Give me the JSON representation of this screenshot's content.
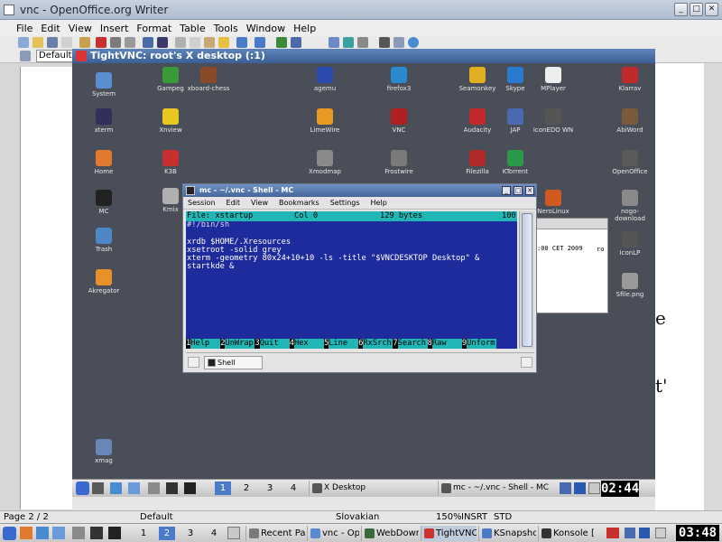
{
  "openoffice": {
    "title": "vnc - OpenOffice.org Writer",
    "menu": [
      "File",
      "Edit",
      "View",
      "Insert",
      "Format",
      "Table",
      "Tools",
      "Window",
      "Help"
    ],
    "paragraph_style": "Default",
    "status": {
      "page": "Page 2 / 2",
      "style": "Default",
      "language": "Slovakian",
      "zoom": "150%",
      "insert_mode": "INSRT",
      "selection_mode": "STD"
    },
    "page_glyphs": [
      "e",
      "t'"
    ]
  },
  "vnc": {
    "title": "TightVNC: root's X desktop (:1)"
  },
  "desktop_icons": [
    {
      "id": "system",
      "label": "System",
      "glyph": "computer-icon",
      "color": "#5a8fcf"
    },
    {
      "id": "xterm",
      "label": "xterm",
      "glyph": "terminal-icon",
      "color": "#30305a"
    },
    {
      "id": "home",
      "label": "Home",
      "glyph": "home-icon",
      "color": "#e07a2e"
    },
    {
      "id": "mc",
      "label": "MC",
      "glyph": "monitor-icon",
      "color": "#222222"
    },
    {
      "id": "trash",
      "label": "Trash",
      "glyph": "trash-icon",
      "color": "#4d88c4"
    },
    {
      "id": "akregator",
      "label": "Akregator",
      "glyph": "feed-icon",
      "color": "#e8902a"
    },
    {
      "id": "xmag",
      "label": "xmag",
      "glyph": "magnifier-icon",
      "color": "#6a86b8"
    },
    {
      "id": "gampeg",
      "label": "Gampeg",
      "glyph": "recycle-icon",
      "color": "#3a9a3a"
    },
    {
      "id": "xboard",
      "label": "xboard-chess",
      "glyph": "chess-icon",
      "color": "#8a4a2a"
    },
    {
      "id": "xnview",
      "label": "Xnview",
      "glyph": "smiley-icon",
      "color": "#e8c820"
    },
    {
      "id": "k3b",
      "label": "K3B",
      "glyph": "k3b-icon",
      "color": "#c83030"
    },
    {
      "id": "kmix",
      "label": "Kmix",
      "glyph": "speaker-icon",
      "color": "#b0b0b0"
    },
    {
      "id": "agemu",
      "label": "agemu",
      "glyph": "flag-icon",
      "color": "#2a4ab0"
    },
    {
      "id": "limewire",
      "label": "LimeWire",
      "glyph": "lime-icon",
      "color": "#e89a20"
    },
    {
      "id": "xmodmap",
      "label": "Xmodmap",
      "glyph": "keyboard-icon",
      "color": "#8a8a8a"
    },
    {
      "id": "firefox",
      "label": "firefox3",
      "glyph": "globe-icon",
      "color": "#2a8ad0"
    },
    {
      "id": "vnc",
      "label": "VNC",
      "glyph": "vnc-icon",
      "color": "#b02020"
    },
    {
      "id": "frostwire",
      "label": "Frostwire",
      "glyph": "frostwire-icon",
      "color": "#7a7a7a"
    },
    {
      "id": "seamonkey",
      "label": "Seamonkey",
      "glyph": "seamonkey-icon",
      "color": "#e0b020"
    },
    {
      "id": "audacity",
      "label": "Audacity",
      "glyph": "headphones-icon",
      "color": "#c02a2a"
    },
    {
      "id": "filezilla",
      "label": "Filezilla",
      "glyph": "network-icon",
      "color": "#b02a2a"
    },
    {
      "id": "skype",
      "label": "Skype",
      "glyph": "phone-icon",
      "color": "#2a7ad0"
    },
    {
      "id": "jap",
      "label": "JAP",
      "glyph": "shield-icon",
      "color": "#4a6ab0"
    },
    {
      "id": "ktorrent",
      "label": "KTorrent",
      "glyph": "ktorrent-icon",
      "color": "#2a9a4a"
    },
    {
      "id": "mplayer",
      "label": "MPlayer",
      "glyph": "piano-icon",
      "color": "#eeeeee"
    },
    {
      "id": "iconedo",
      "label": "IconEDO WN",
      "glyph": "gnu-icon",
      "color": "#555555"
    },
    {
      "id": "nero",
      "label": "NeroLinux",
      "glyph": "nero-icon",
      "color": "#d05a20"
    },
    {
      "id": "kalzium",
      "label": "Klarrav",
      "glyph": "sqrt-icon",
      "color": "#c02a2a"
    },
    {
      "id": "abiword",
      "label": "AbiWord",
      "glyph": "pen-icon",
      "color": "#7a5a3a"
    },
    {
      "id": "openoffice",
      "label": "OpenOffice",
      "glyph": "document-icon",
      "color": "#5a5a5a"
    },
    {
      "id": "nogo",
      "label": "nogo-download",
      "glyph": "document-icon",
      "color": "#8a8a8a"
    },
    {
      "id": "iconlp",
      "label": "IconLP",
      "glyph": "gnu-icon",
      "color": "#555555"
    },
    {
      "id": "sfile",
      "label": "Sfile.png",
      "glyph": "image-icon",
      "color": "#9a9a9a"
    }
  ],
  "mc_window": {
    "title": "mc - ~/.vnc - Shell - MC",
    "menu": [
      "Session",
      "Edit",
      "View",
      "Bookmarks",
      "Settings",
      "Help"
    ],
    "status": {
      "file": "File: xstartup",
      "col": "Col 0",
      "bytes": "129 bytes",
      "pct": "100"
    },
    "lines": [
      "#!/bin/sh",
      "",
      "xrdb $HOME/.Xresources",
      "xsetroot -solid grey",
      "xterm -geometry 80x24+10+10 -ls -title \"$VNCDESKTOP Desktop\" &",
      "startkde &"
    ],
    "fkeys": [
      {
        "n": "1",
        "l": "Help"
      },
      {
        "n": "2",
        "l": "UnWrap"
      },
      {
        "n": "3",
        "l": "Quit"
      },
      {
        "n": "4",
        "l": "Hex"
      },
      {
        "n": "5",
        "l": "Line"
      },
      {
        "n": "6",
        "l": "RxSrch"
      },
      {
        "n": "7",
        "l": "Search"
      },
      {
        "n": "8",
        "l": "Raw"
      },
      {
        "n": "9",
        "l": "Unform"
      }
    ],
    "tab_label": "Shell"
  },
  "background_window": {
    "time_text": ":00 CET 2009",
    "suffix": "ro"
  },
  "vnc_panel": {
    "pager": [
      "1",
      "2",
      "3",
      "4"
    ],
    "tasks": [
      {
        "label": "X Desktop",
        "active": false
      },
      {
        "label": "mc - ~/.vnc - Shell - MC",
        "active": false
      }
    ],
    "clock": "02:44"
  },
  "host_taskbar": {
    "pager": [
      "1",
      "2",
      "3",
      "4"
    ],
    "tasks": [
      {
        "label": "Recent Page",
        "active": false
      },
      {
        "label": "vnc - OpenO",
        "active": false
      },
      {
        "label": "WebDownlo",
        "active": false
      },
      {
        "label": "TightVNC:",
        "active": true
      },
      {
        "label": "KSnapshot",
        "active": false
      },
      {
        "label": "Konsole [",
        "active": false
      }
    ],
    "clock": "03:48"
  },
  "colors": {
    "accent": "#3b5f94",
    "terminal_bg": "#1e2b9c",
    "terminal_bar": "#21b6b6"
  }
}
